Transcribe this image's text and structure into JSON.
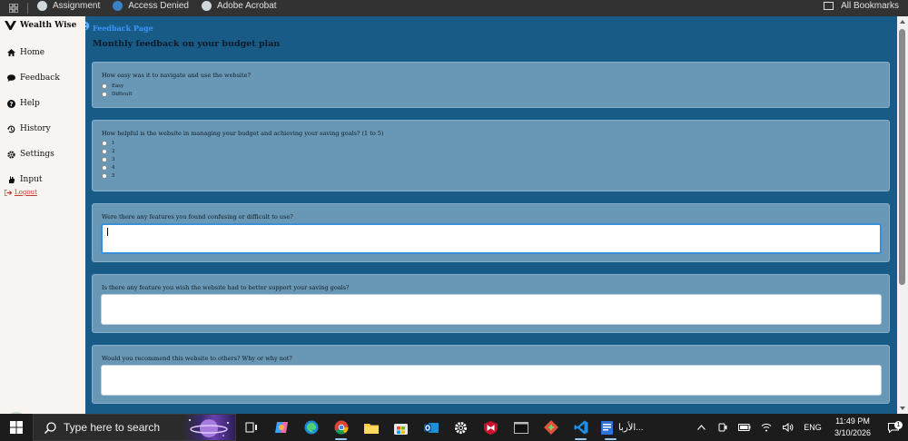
{
  "bookmarks_bar": {
    "items": [
      {
        "label": "Assignment",
        "icon": "globe-icon"
      },
      {
        "label": "Access Denied",
        "icon": "shield-icon"
      },
      {
        "label": "Adobe Acrobat",
        "icon": "globe-icon"
      }
    ],
    "all_bookmarks_label": "All Bookmarks"
  },
  "sidebar": {
    "brand": "Wealth Wise",
    "items": [
      {
        "label": "Home",
        "icon": "home-icon"
      },
      {
        "label": "Feedback",
        "icon": "comment-icon"
      },
      {
        "label": "Help",
        "icon": "question-icon"
      },
      {
        "label": "History",
        "icon": "history-icon"
      },
      {
        "label": "Settings",
        "icon": "gear-icon"
      },
      {
        "label": "Input",
        "icon": "hand-icon"
      }
    ],
    "logout_label": "Logout"
  },
  "main": {
    "page_link": "Feedback Page",
    "title": "Monthly feedback on your budget plan",
    "q1": {
      "text": "How easy was it to navigate and use the website?",
      "options": [
        "Easy",
        "Difficult"
      ]
    },
    "q2": {
      "text": "How helpful is the website in managing your budget and achieving your saving goals? (1 to 5)",
      "options": [
        "1",
        "2",
        "3",
        "4",
        "5"
      ]
    },
    "q3": {
      "text": "Were there any features you found confusing or difficult to use?",
      "value": ""
    },
    "q4": {
      "text": "Is there any feature you wish the website had to better support your saving goals?",
      "value": ""
    },
    "q5": {
      "text": "Would you recommend this website to others? Why or why not?",
      "value": ""
    }
  },
  "taskbar": {
    "search_placeholder": "Type here to search",
    "app_label": "الأربا...",
    "language": "ENG",
    "time": "11:49 PM",
    "date": "3/10/2026",
    "notification_count": "1"
  },
  "colors": {
    "main_bg": "#175b86",
    "card_bg": "#6998b7",
    "sidebar_bg": "#f8f4f2",
    "link": "#3d96ff",
    "logout": "#c0392b"
  }
}
